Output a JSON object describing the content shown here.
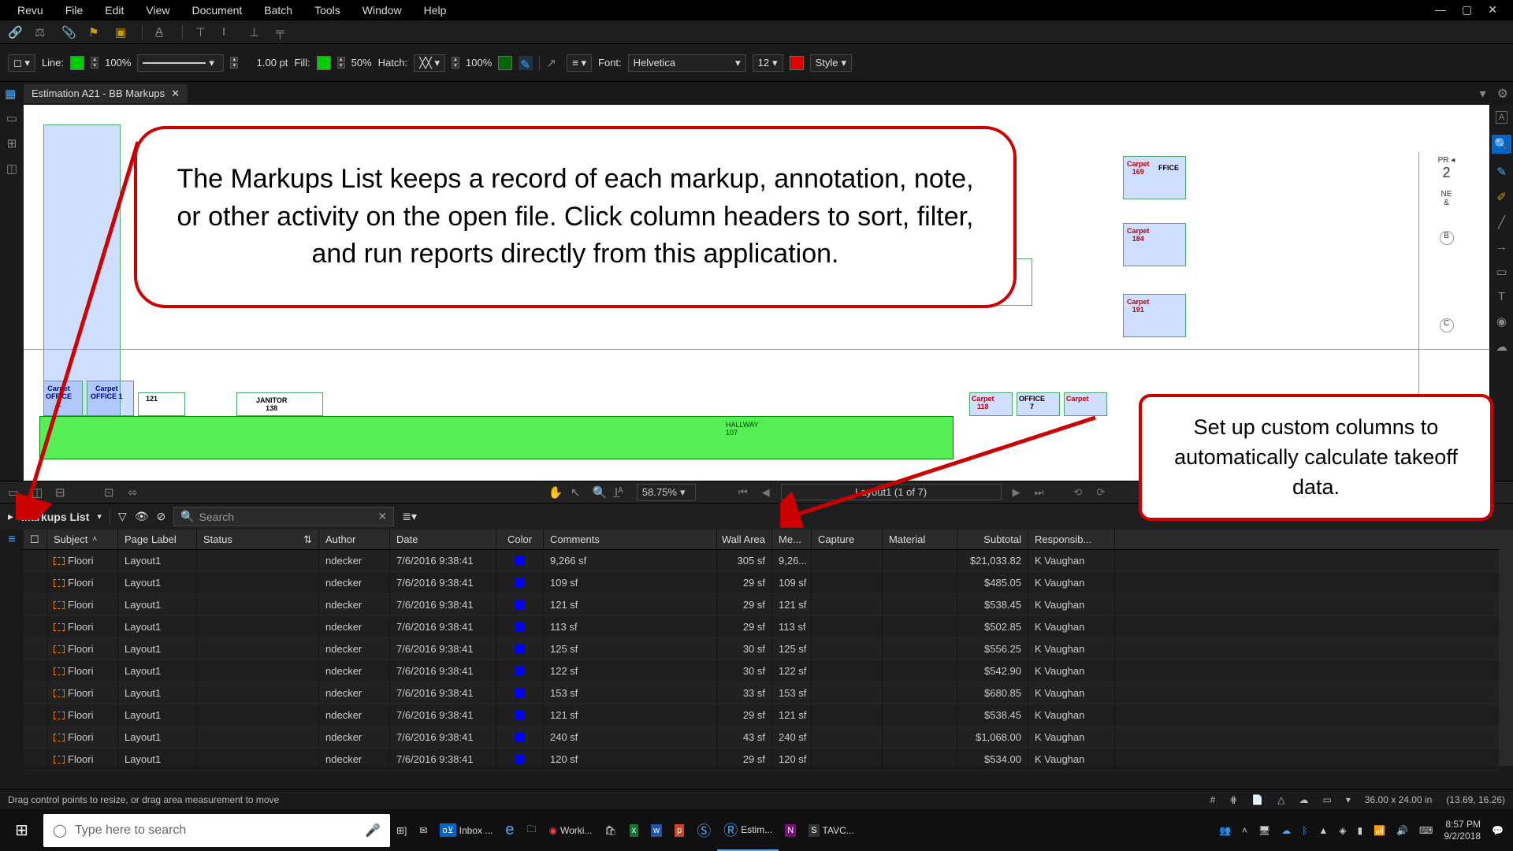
{
  "window": {
    "title": "Estimation A21 - BB Markups"
  },
  "menus": [
    "Revu",
    "File",
    "Edit",
    "View",
    "Document",
    "Batch",
    "Tools",
    "Window",
    "Help"
  ],
  "toolbar2": {
    "line_label": "Line:",
    "line_pct": "100%",
    "weight": "1.00 pt",
    "fill_label": "Fill:",
    "fill_pct": "50%",
    "hatch_label": "Hatch:",
    "hatch_pct": "100%",
    "font_label": "Font:",
    "font_name": "Helvetica",
    "font_size": "12",
    "style_label": "Style"
  },
  "nav": {
    "zoom": "58.75%",
    "page": "Layout1 (1 of 7)"
  },
  "markups": {
    "title": "Markups List",
    "search_placeholder": "Search",
    "columns": [
      "Subject",
      "Page Label",
      "Status",
      "Author",
      "Date",
      "Color",
      "Comments",
      "Wall Area",
      "Me...",
      "Capture",
      "Material",
      "Subtotal",
      "Responsib..."
    ],
    "rows": [
      {
        "subject": "Floori",
        "page": "Layout1",
        "author": "ndecker",
        "date": "7/6/2016 9:38:41",
        "comments": "9,266 sf",
        "wall": "305 sf",
        "me": "9,26...",
        "subtotal": "$21,033.82",
        "resp": "K Vaughan"
      },
      {
        "subject": "Floori",
        "page": "Layout1",
        "author": "ndecker",
        "date": "7/6/2016 9:38:41",
        "comments": "109 sf",
        "wall": "29 sf",
        "me": "109 sf",
        "subtotal": "$485.05",
        "resp": "K Vaughan"
      },
      {
        "subject": "Floori",
        "page": "Layout1",
        "author": "ndecker",
        "date": "7/6/2016 9:38:41",
        "comments": "121 sf",
        "wall": "29 sf",
        "me": "121 sf",
        "subtotal": "$538.45",
        "resp": "K Vaughan"
      },
      {
        "subject": "Floori",
        "page": "Layout1",
        "author": "ndecker",
        "date": "7/6/2016 9:38:41",
        "comments": "113 sf",
        "wall": "29 sf",
        "me": "113 sf",
        "subtotal": "$502.85",
        "resp": "K Vaughan"
      },
      {
        "subject": "Floori",
        "page": "Layout1",
        "author": "ndecker",
        "date": "7/6/2016 9:38:41",
        "comments": "125 sf",
        "wall": "30 sf",
        "me": "125 sf",
        "subtotal": "$556.25",
        "resp": "K Vaughan"
      },
      {
        "subject": "Floori",
        "page": "Layout1",
        "author": "ndecker",
        "date": "7/6/2016 9:38:41",
        "comments": "122 sf",
        "wall": "30 sf",
        "me": "122 sf",
        "subtotal": "$542.90",
        "resp": "K Vaughan"
      },
      {
        "subject": "Floori",
        "page": "Layout1",
        "author": "ndecker",
        "date": "7/6/2016 9:38:41",
        "comments": "153 sf",
        "wall": "33 sf",
        "me": "153 sf",
        "subtotal": "$680.85",
        "resp": "K Vaughan"
      },
      {
        "subject": "Floori",
        "page": "Layout1",
        "author": "ndecker",
        "date": "7/6/2016 9:38:41",
        "comments": "121 sf",
        "wall": "29 sf",
        "me": "121 sf",
        "subtotal": "$538.45",
        "resp": "K Vaughan"
      },
      {
        "subject": "Floori",
        "page": "Layout1",
        "author": "ndecker",
        "date": "7/6/2016 9:38:41",
        "comments": "240 sf",
        "wall": "43 sf",
        "me": "240 sf",
        "subtotal": "$1,068.00",
        "resp": "K Vaughan"
      },
      {
        "subject": "Floori",
        "page": "Layout1",
        "author": "ndecker",
        "date": "7/6/2016 9:38:41",
        "comments": "120 sf",
        "wall": "29 sf",
        "me": "120 sf",
        "subtotal": "$534.00",
        "resp": "K Vaughan"
      }
    ]
  },
  "status": {
    "hint": "Drag control points to resize, or drag area measurement to move",
    "dims": "36.00 x 24.00 in",
    "coords": "(13.69, 16.26)"
  },
  "callouts": {
    "c1": "The Markups List keeps a record of each markup, annotation, note, or other activity on the open file. Click column headers to sort, filter, and run reports directly from this application.",
    "c2": "Set up custom columns to automatically calculate takeoff data."
  },
  "taskbar": {
    "search_placeholder": "Type here to search",
    "items": [
      "Inbox ...",
      "Worki...",
      "Estim...",
      "TAVC..."
    ],
    "time": "8:57 PM",
    "date": "9/2/2018"
  }
}
